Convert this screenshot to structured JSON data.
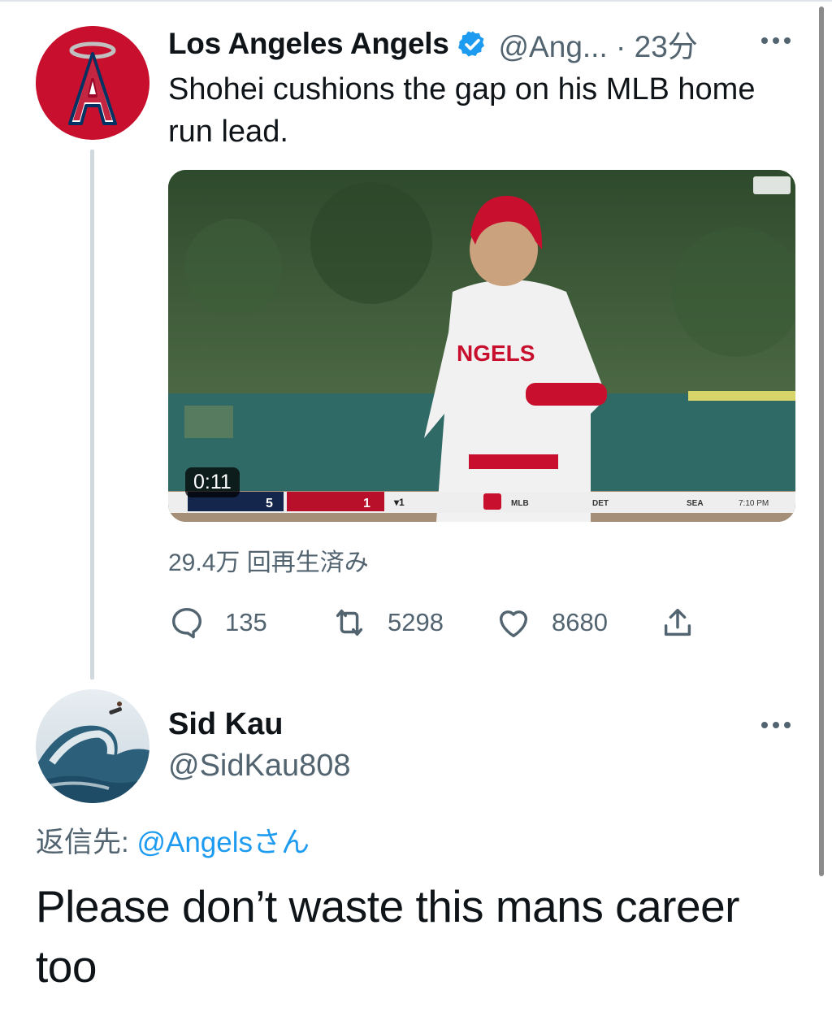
{
  "tweet": {
    "display_name": "Los Angeles Angels",
    "handle_time": "@Ang... · 23分",
    "text": "Shohei cushions the gap on his MLB home run lead.",
    "video_duration": "0:11",
    "views": "29.4万 回再生済み",
    "stats": {
      "replies": "135",
      "retweets": "5298",
      "likes": "8680"
    },
    "icons": [
      "verified-icon",
      "more-icon",
      "reply-icon",
      "retweet-icon",
      "like-icon",
      "share-icon"
    ]
  },
  "reply": {
    "display_name": "Sid Kau",
    "handle": "@SidKau808",
    "replying_label": "返信先:",
    "replying_mention": "@Angelsさん",
    "text": "Please don’t waste this mans career too"
  },
  "scoreboard": {
    "away_score": "5",
    "home_score": "1",
    "inning": "▾1",
    "teams": [
      "MLB",
      "DET",
      "SEA"
    ],
    "time": "7:10 PM"
  },
  "colors": {
    "accent": "#1d9bf0",
    "secondary_text": "#536471",
    "angels_red": "#c8102e"
  }
}
